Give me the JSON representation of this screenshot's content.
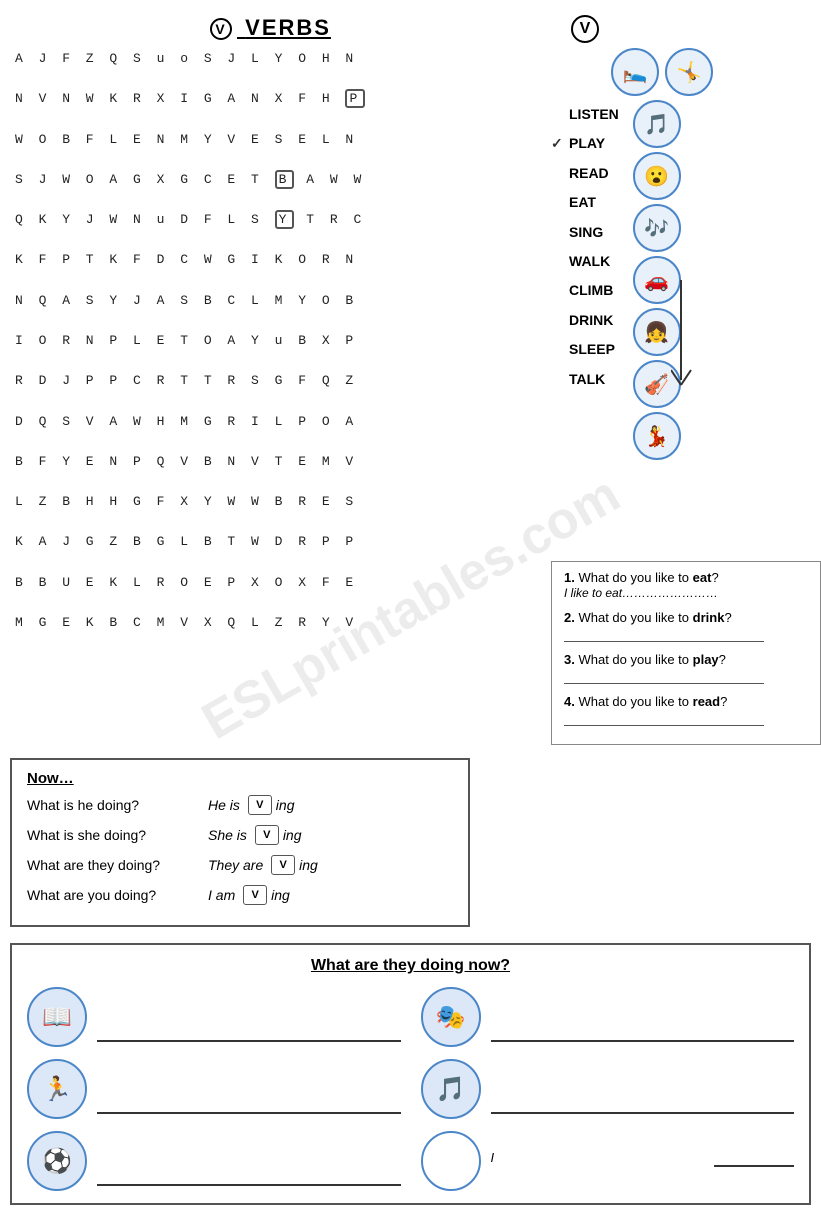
{
  "title": {
    "circle_symbol": "V",
    "text": "VERBS"
  },
  "wordsearch": {
    "rows": [
      "A  J  F  Z  Q  S  u  o  S  J  L  Y  O  H  N",
      "N  V  N  W  K  R  X  I  G  A  N  X  F  H  P",
      "W  O  B  F  L  E  N  M  Y  V  E  S  E  L  N",
      "S  J  W  O  A  G  X  G  C  E  T  B  A  W  W",
      "Q  K  Y  J  W  N  u  D  F  L  S  Y  T  R  C",
      "K  F  P  T  K  F  D  C  W  G  I  K  O  R  N",
      "N  Q  A  S  Y  J  A  S  B  C  L  M  Y  O  B",
      "I  O  R  N  P  L  E  T  O  A  Y  u  B  X  P",
      "R  D  J  P  P  C  R  T  T  R  S  G  F  Q  Z",
      "D  Q  S  V  A  W  H  M  G  R  I  L  P  O  A",
      "B  F  Y  E  N  P  Q  V  B  N  V  T  E  M  V",
      "L  Z  B  H  H  G  F  X  Y  W  W  B  R  E  S",
      "K  A  J  G  Z  B  G  L  B  T  W  D  R  P  P",
      "B  B  U  E  K  L  R  O  E  P  X  O  X  F  E",
      "M  G  E  K  B  C  M  V  X  Q  L  Z  R  Y  V"
    ]
  },
  "verb_list": {
    "circle_symbol": "V",
    "verbs": [
      "LISTEN",
      "PLAY",
      "READ",
      "EAT",
      "SING",
      "WALK",
      "CLIMB",
      "DRINK",
      "SLEEP",
      "TALK"
    ],
    "checked": [
      1
    ]
  },
  "questions": {
    "items": [
      {
        "num": "1.",
        "question": "What do you like to eat?",
        "answer_prefix": "I like to eat",
        "answer_dots": "……………………"
      },
      {
        "num": "2.",
        "question": "What do you like to drink?"
      },
      {
        "num": "3.",
        "question": "What do you like to play?"
      },
      {
        "num": "4.",
        "question": "What do you like to read?"
      }
    ]
  },
  "now_section": {
    "title": "Now…",
    "rows": [
      {
        "question": "What is he doing?",
        "answer_start": "He is ",
        "answer_end": "ing"
      },
      {
        "question": "What is she doing?",
        "answer_start": "She is ",
        "answer_end": "ing"
      },
      {
        "question": "What are they doing?",
        "answer_start": "They are ",
        "answer_end": "ing"
      },
      {
        "question": "What are you doing?",
        "answer_start": "I am ",
        "answer_end": "ing"
      }
    ],
    "verb_symbol": "V"
  },
  "bottom_section": {
    "title": "What are they doing now?",
    "items": [
      {
        "icon": "📖",
        "col": "left",
        "has_i_line": false
      },
      {
        "icon": "🎭",
        "col": "right",
        "has_i_line": false
      },
      {
        "icon": "🏃",
        "col": "left",
        "has_i_line": false
      },
      {
        "icon": "🎵",
        "col": "right",
        "has_i_line": false
      },
      {
        "icon": "⚽",
        "col": "left",
        "has_i_line": true,
        "i_text": ""
      },
      {
        "icon": "",
        "col": "right",
        "has_i_line": true,
        "i_text": "I"
      }
    ]
  },
  "watermark": "ESLprintables.com"
}
